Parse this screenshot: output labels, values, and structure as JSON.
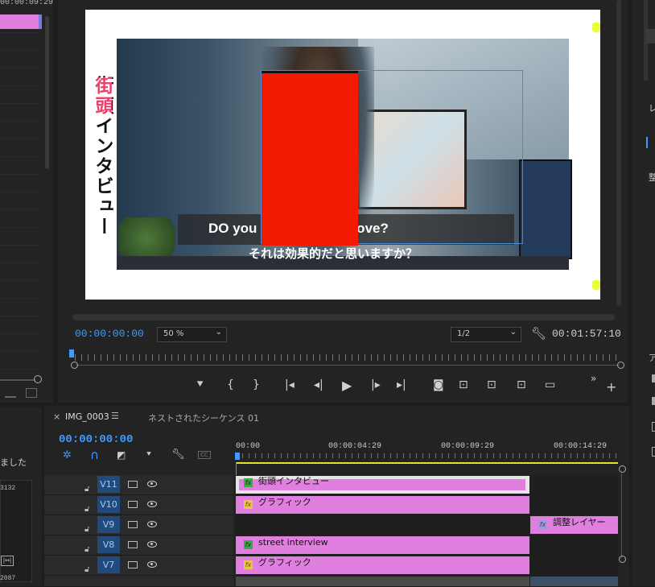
{
  "project_panel": {
    "timecode_top": "00:00:09:29",
    "status_text": "ました",
    "number_a": "3132",
    "number_b": "2087"
  },
  "program_monitor": {
    "title_vertical": "街頭インタビュー",
    "subtitle_en": "DO you        en`t effectiove?",
    "subtitle_jp": "それは効果的だと思いますか？",
    "current_timecode": "00:00:00:00",
    "zoom": "50 %",
    "resolution": "1/2",
    "duration": "00:01:57:10"
  },
  "right_panel": {
    "label_1": "レ",
    "label_2": "整",
    "label_3": "ア"
  },
  "timeline": {
    "tabs": [
      {
        "label": "IMG_0003",
        "active": true
      },
      {
        "label": "ネストされたシーケンス 01",
        "active": false
      }
    ],
    "timecode": "00:00:00:00",
    "ruler": [
      "00:00",
      "00:00:04:29",
      "00:00:09:29",
      "00:00:14:29"
    ],
    "tracks": [
      {
        "name": "V11",
        "clips": [
          {
            "label": "街頭インタビュー",
            "icon": "g"
          }
        ]
      },
      {
        "name": "V10",
        "clips": [
          {
            "label": "グラフィック",
            "icon": "y"
          }
        ]
      },
      {
        "name": "V9",
        "clips": [
          {
            "label": "調整レイヤー",
            "icon": "p"
          }
        ]
      },
      {
        "name": "V8",
        "clips": [
          {
            "label": "street interview",
            "icon": "g"
          }
        ]
      },
      {
        "name": "V7",
        "clips": [
          {
            "label": "グラフィック",
            "icon": "y"
          }
        ]
      }
    ]
  },
  "colors": {
    "accent_blue": "#3f9bff",
    "clip_pink": "#e17fe0",
    "red_box": "#f21a00",
    "title_pink": "#e8315f"
  }
}
